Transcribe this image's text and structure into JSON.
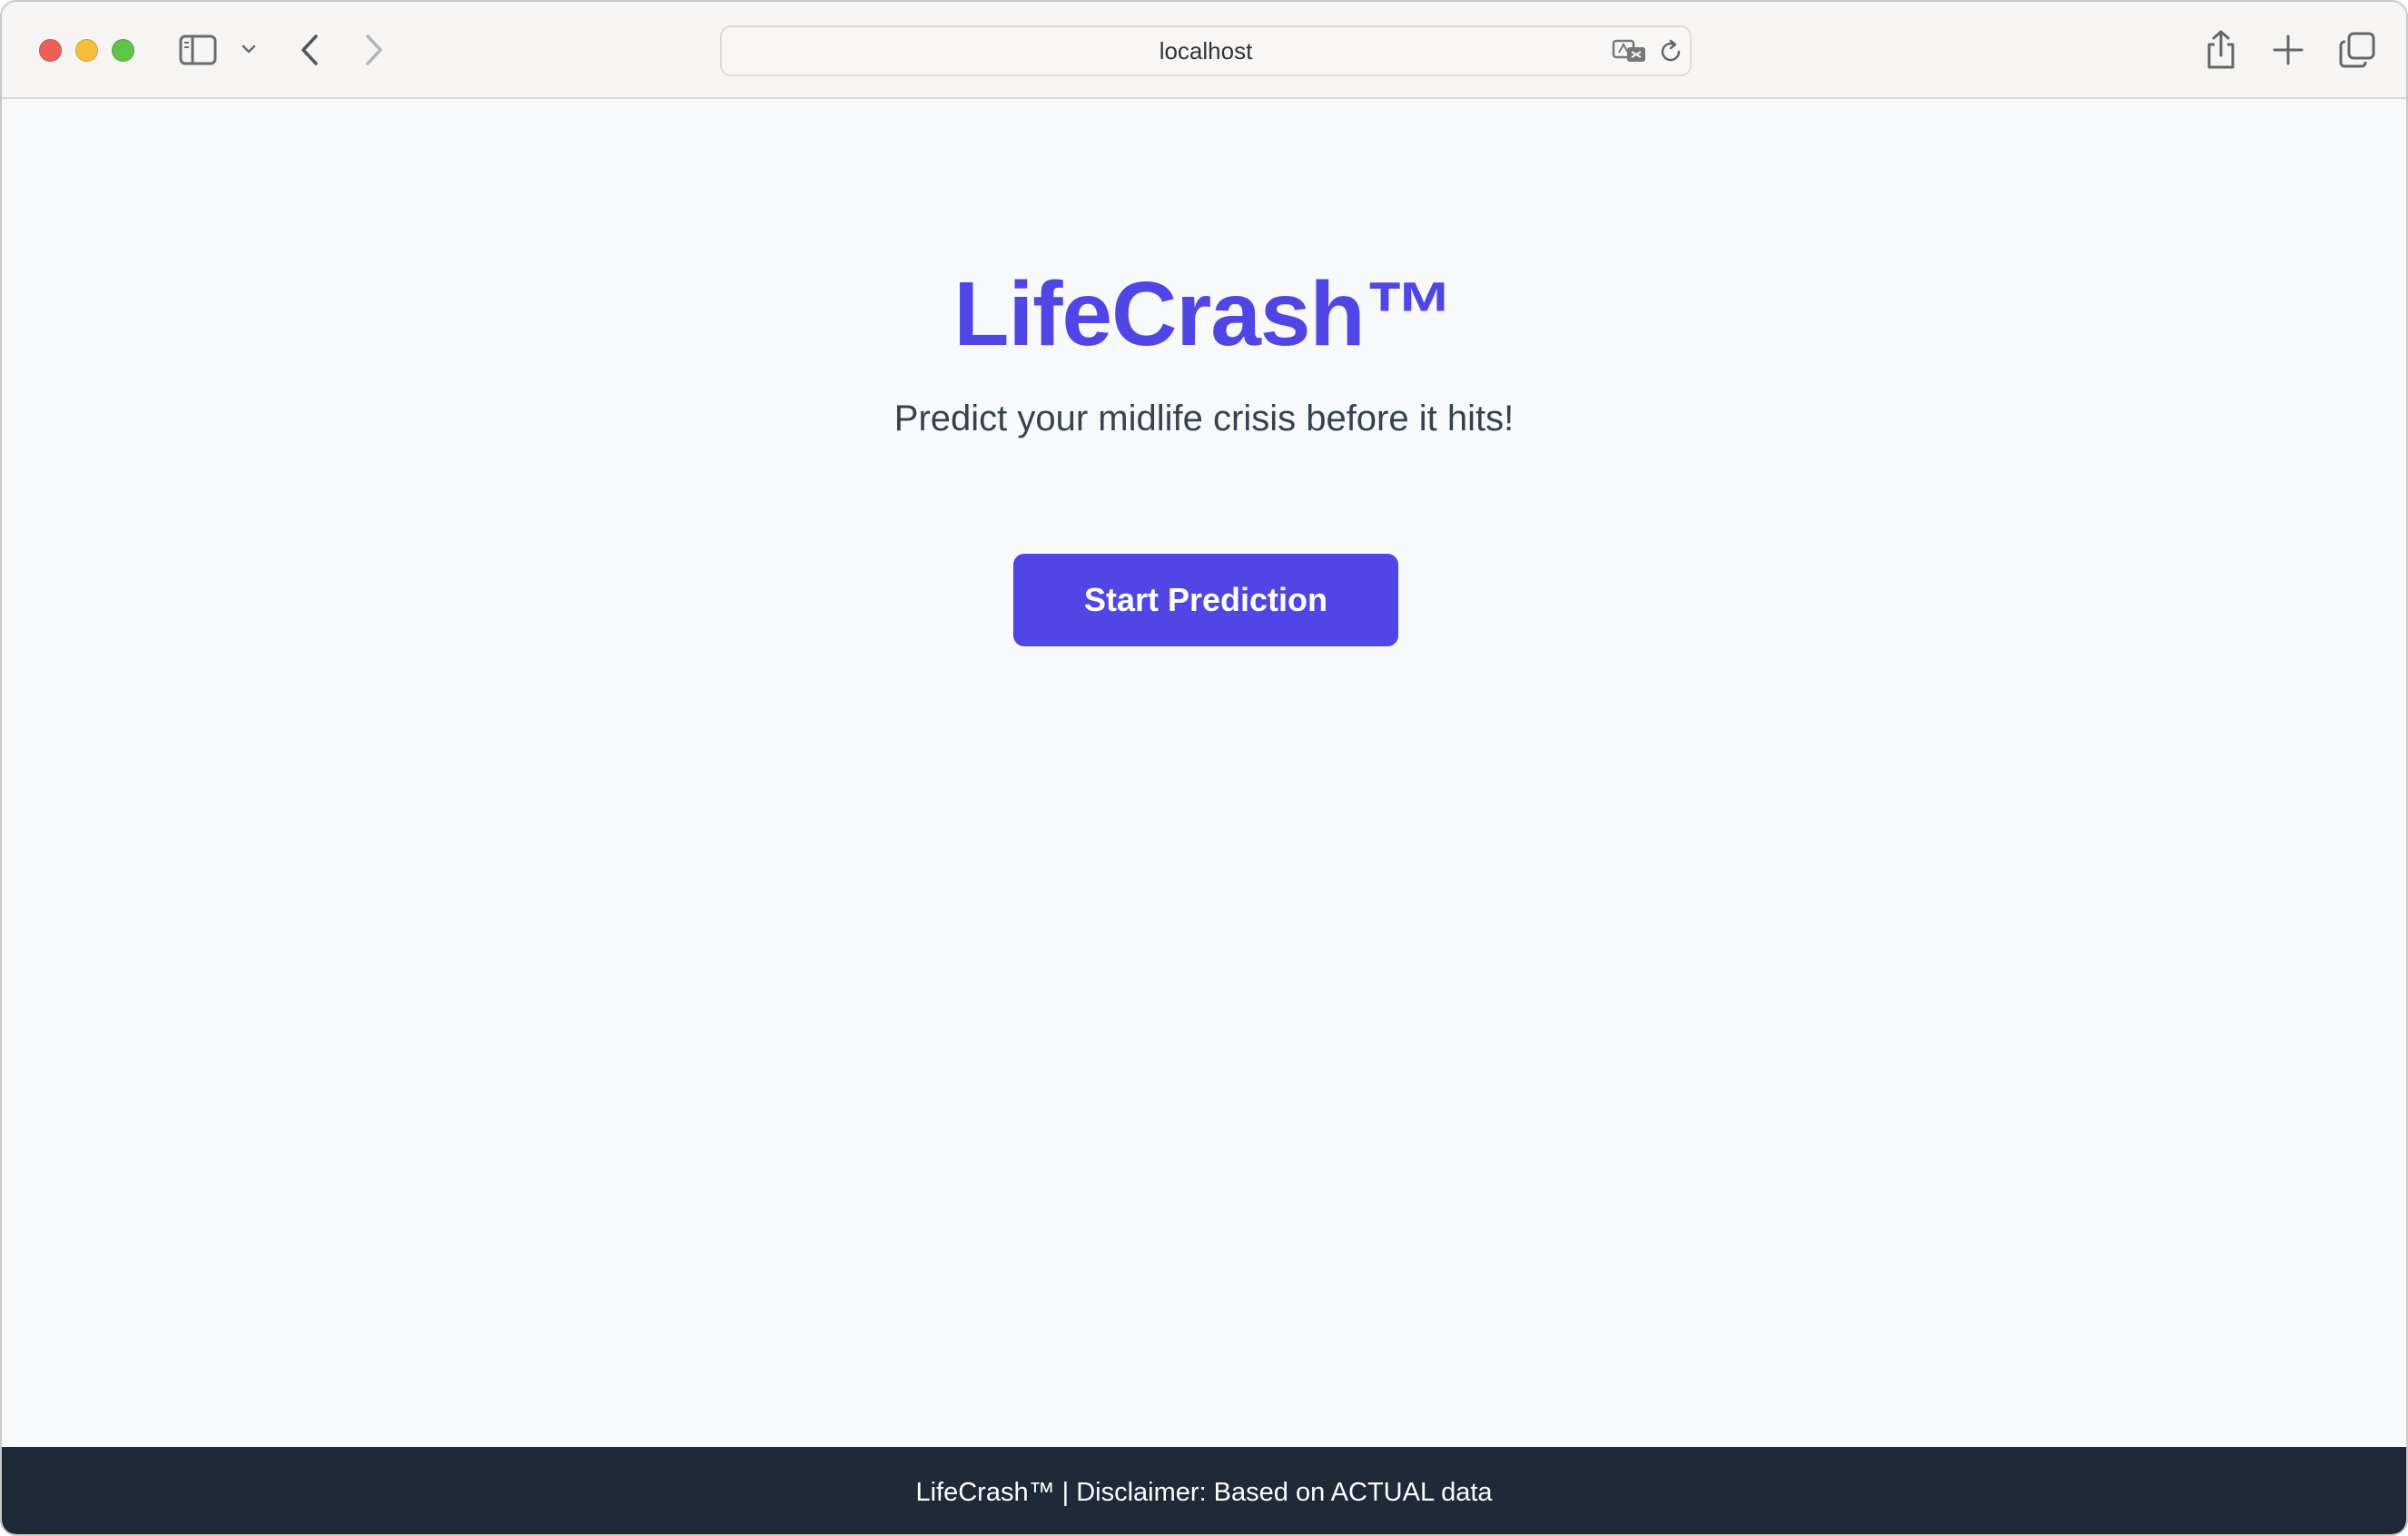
{
  "browser": {
    "url": "localhost",
    "icons": [
      "sidebar-icon",
      "chevron-down-icon",
      "back-icon",
      "forward-icon",
      "translate-icon",
      "reload-icon",
      "share-icon",
      "new-tab-icon",
      "tab-overview-icon"
    ]
  },
  "hero": {
    "title": "LifeCrash™",
    "subtitle": "Predict your midlife crisis before it hits!",
    "button_label": "Start Prediction"
  },
  "footer": {
    "text": "LifeCrash™ | Disclaimer: Based on ACTUAL data"
  },
  "colors": {
    "accent": "#4f46e5",
    "footer_bg": "#1f2937",
    "page_bg": "#f8f9fa"
  }
}
